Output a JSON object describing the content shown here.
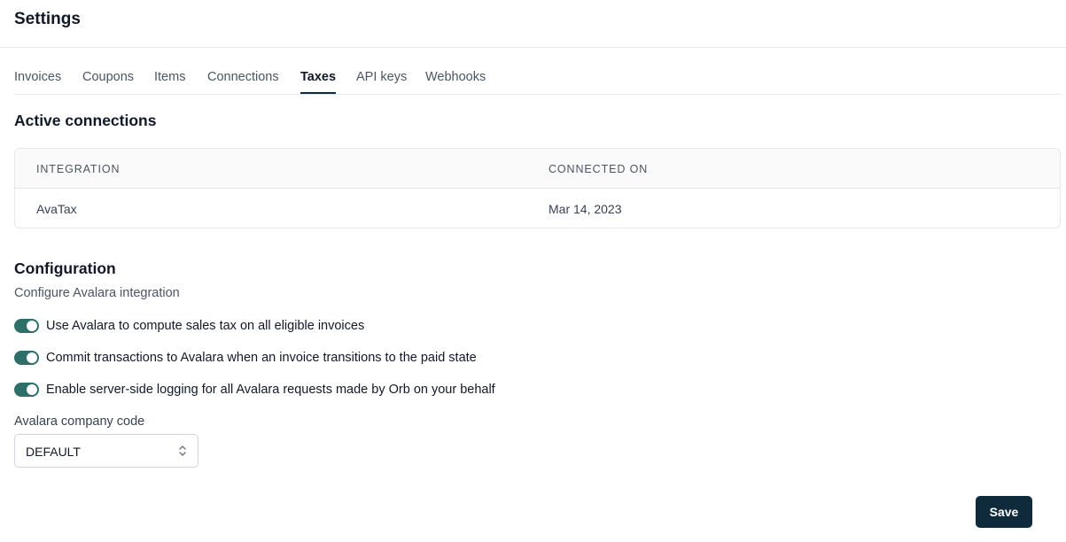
{
  "header": {
    "title": "Settings"
  },
  "tabs": [
    {
      "label": "Invoices",
      "active": false
    },
    {
      "label": "Coupons",
      "active": false
    },
    {
      "label": "Items",
      "active": false
    },
    {
      "label": "Connections",
      "active": false
    },
    {
      "label": "Taxes",
      "active": true
    },
    {
      "label": "API keys",
      "active": false
    },
    {
      "label": "Webhooks",
      "active": false
    }
  ],
  "active_connections": {
    "title": "Active connections",
    "columns": [
      "INTEGRATION",
      "CONNECTED ON"
    ],
    "rows": [
      {
        "integration": "AvaTax",
        "connected_on": "Mar 14, 2023"
      }
    ]
  },
  "configuration": {
    "title": "Configuration",
    "subtitle": "Configure Avalara integration",
    "toggles": [
      {
        "label": "Use Avalara to compute sales tax on all eligible invoices",
        "enabled": true
      },
      {
        "label": "Commit transactions to Avalara when an invoice transitions to the paid state",
        "enabled": true
      },
      {
        "label": "Enable server-side logging for all Avalara requests made by Orb on your behalf",
        "enabled": true
      }
    ],
    "company_code": {
      "label": "Avalara company code",
      "value": "DEFAULT"
    }
  },
  "actions": {
    "save_label": "Save"
  },
  "colors": {
    "accent": "#2f6f6a",
    "primary_button": "#0f2a3a",
    "border": "#e5e7eb"
  },
  "icons": {
    "select": "chevron-up-down-icon"
  }
}
